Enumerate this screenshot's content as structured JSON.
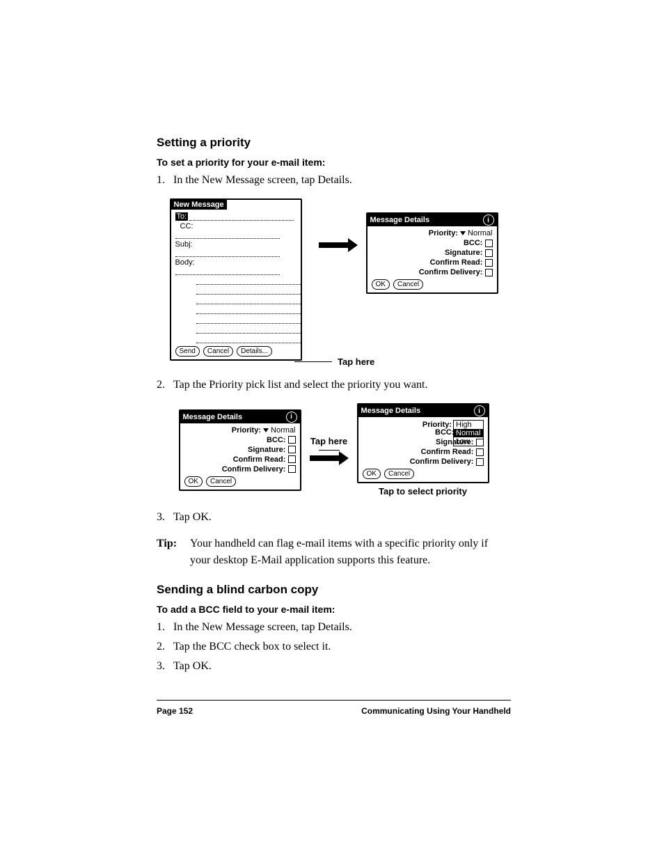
{
  "section1": {
    "heading": "Setting a priority",
    "subheading": "To set a priority for your e-mail item:",
    "step1_num": "1.",
    "step1_text": "In the New Message screen, tap Details.",
    "tap_here": "Tap here",
    "step2_num": "2.",
    "step2_text": "Tap the Priority pick list and select the priority you want.",
    "tap_here2": "Tap here",
    "caption2": "Tap to select priority",
    "step3_num": "3.",
    "step3_text": "Tap OK.",
    "tip_label": "Tip:",
    "tip_text": "Your handheld can flag e-mail items with a specific priority only if your desktop E-Mail application supports this feature."
  },
  "section2": {
    "heading": "Sending a blind carbon copy",
    "subheading": "To add a BCC field to your e-mail item:",
    "s1n": "1.",
    "s1": "In the New Message screen, tap Details.",
    "s2n": "2.",
    "s2": "Tap the BCC check box to select it.",
    "s3n": "3.",
    "s3": "Tap OK."
  },
  "newmsg": {
    "title": "New Message",
    "to": "To:",
    "cc": "CC:",
    "subj": "Subj:",
    "body": "Body:",
    "send": "Send",
    "cancel": "Cancel",
    "details": "Details..."
  },
  "details": {
    "title": "Message Details",
    "info": "i",
    "priority": "Priority:",
    "priority_val": "Normal",
    "bcc": "BCC:",
    "signature": "Signature:",
    "confirm_read": "Confirm Read:",
    "confirm_delivery": "Confirm Delivery:",
    "ok": "OK",
    "cancel": "Cancel",
    "options": {
      "high": "High",
      "normal": "Normal",
      "low": "Low"
    }
  },
  "footer": {
    "page": "Page 152",
    "chapter": "Communicating Using Your Handheld"
  }
}
